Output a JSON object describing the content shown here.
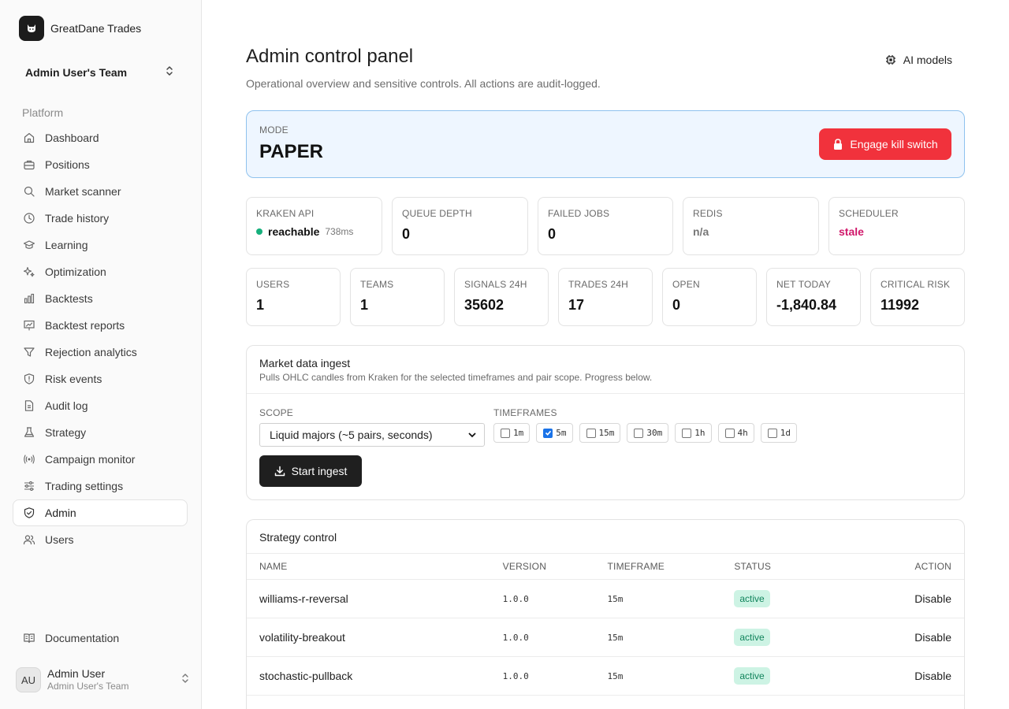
{
  "brand": {
    "name": "GreatDane Trades"
  },
  "team": {
    "name": "Admin User's Team"
  },
  "sidebar": {
    "section_label": "Platform",
    "items": [
      {
        "label": "Dashboard",
        "icon": "home-icon"
      },
      {
        "label": "Positions",
        "icon": "briefcase-icon"
      },
      {
        "label": "Market scanner",
        "icon": "search-icon"
      },
      {
        "label": "Trade history",
        "icon": "clock-icon"
      },
      {
        "label": "Learning",
        "icon": "graduation-cap-icon"
      },
      {
        "label": "Optimization",
        "icon": "sparkles-icon"
      },
      {
        "label": "Backtests",
        "icon": "bar-chart-icon"
      },
      {
        "label": "Backtest reports",
        "icon": "presentation-chart-icon"
      },
      {
        "label": "Rejection analytics",
        "icon": "funnel-icon"
      },
      {
        "label": "Risk events",
        "icon": "shield-alert-icon"
      },
      {
        "label": "Audit log",
        "icon": "file-text-icon"
      },
      {
        "label": "Strategy",
        "icon": "flask-icon"
      },
      {
        "label": "Campaign monitor",
        "icon": "radio-icon"
      },
      {
        "label": "Trading settings",
        "icon": "sliders-icon"
      },
      {
        "label": "Admin",
        "icon": "shield-check-icon"
      },
      {
        "label": "Users",
        "icon": "users-icon"
      }
    ],
    "active": "Admin",
    "documentation_label": "Documentation"
  },
  "user": {
    "initials": "AU",
    "name": "Admin User",
    "team": "Admin User's Team"
  },
  "header": {
    "title": "Admin control panel",
    "subtitle": "Operational overview and sensitive controls. All actions are audit-logged.",
    "ai_models_label": "AI models"
  },
  "mode": {
    "label": "MODE",
    "value": "PAPER",
    "kill_switch_label": "Engage kill switch"
  },
  "health": {
    "kraken_label": "KRAKEN API",
    "kraken_status": "reachable",
    "kraken_latency": "738ms",
    "queue_label": "QUEUE DEPTH",
    "queue_value": "0",
    "failed_label": "FAILED JOBS",
    "failed_value": "0",
    "redis_label": "REDIS",
    "redis_value": "n/a",
    "scheduler_label": "SCHEDULER",
    "scheduler_value": "stale"
  },
  "stats": {
    "users_label": "USERS",
    "users_value": "1",
    "teams_label": "TEAMS",
    "teams_value": "1",
    "signals_label": "SIGNALS 24H",
    "signals_value": "35602",
    "trades_label": "TRADES 24H",
    "trades_value": "17",
    "open_label": "OPEN",
    "open_value": "0",
    "net_label": "NET TODAY",
    "net_value": "-1,840.84",
    "risk_label": "CRITICAL RISK",
    "risk_value": "11992"
  },
  "ingest": {
    "title": "Market data ingest",
    "description": "Pulls OHLC candles from Kraken for the selected timeframes and pair scope. Progress below.",
    "scope_label": "SCOPE",
    "scope_value": "Liquid majors (~5 pairs, seconds)",
    "timeframes_label": "TIMEFRAMES",
    "timeframes": [
      {
        "label": "1m",
        "checked": false
      },
      {
        "label": "5m",
        "checked": true
      },
      {
        "label": "15m",
        "checked": false
      },
      {
        "label": "30m",
        "checked": false
      },
      {
        "label": "1h",
        "checked": false
      },
      {
        "label": "4h",
        "checked": false
      },
      {
        "label": "1d",
        "checked": false
      }
    ],
    "start_label": "Start ingest"
  },
  "strategy": {
    "title": "Strategy control",
    "columns": {
      "name": "NAME",
      "version": "VERSION",
      "timeframe": "TIMEFRAME",
      "status": "STATUS",
      "action": "ACTION"
    },
    "rows": [
      {
        "name": "williams-r-reversal",
        "version": "1.0.0",
        "timeframe": "15m",
        "status": "active",
        "action": "Disable"
      },
      {
        "name": "volatility-breakout",
        "version": "1.0.0",
        "timeframe": "15m",
        "status": "active",
        "action": "Disable"
      },
      {
        "name": "stochastic-pullback",
        "version": "1.0.0",
        "timeframe": "15m",
        "status": "active",
        "action": "Disable"
      }
    ]
  }
}
